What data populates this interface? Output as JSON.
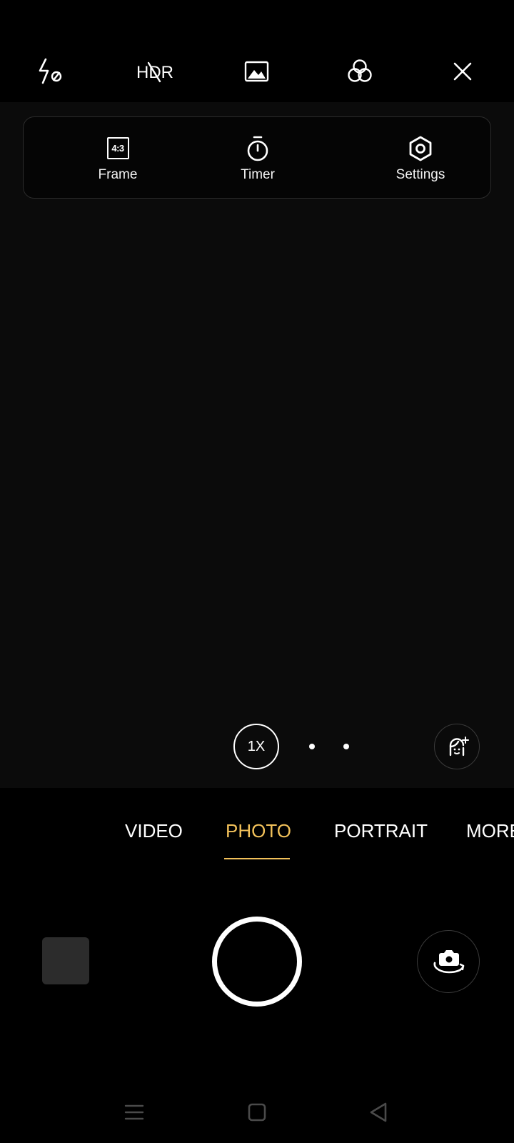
{
  "top_bar": {
    "icons": [
      "flash-off-icon",
      "hdr-off-icon",
      "image-icon",
      "filter-icon",
      "close-icon"
    ],
    "hdr_label": "HDR"
  },
  "quick_panel": {
    "frame": {
      "ratio": "4:3",
      "label": "Frame",
      "icon": "aspect-ratio-icon"
    },
    "timer": {
      "label": "Timer",
      "icon": "timer-icon"
    },
    "settings": {
      "label": "Settings",
      "icon": "settings-icon"
    }
  },
  "zoom": {
    "label": "1X"
  },
  "modes": {
    "items": [
      "VIDEO",
      "PHOTO",
      "PORTRAIT",
      "MORE"
    ],
    "selected": "PHOTO"
  },
  "controls": {
    "gallery_icon": "gallery-thumbnail",
    "shutter_icon": "shutter-button",
    "flip_icon": "flip-camera-icon"
  },
  "nav": {
    "icons": [
      "menu-icon",
      "home-icon",
      "back-icon"
    ]
  },
  "colors": {
    "accent": "#f2c15a",
    "background": "#000000",
    "viewfinder": "#0b0b0b"
  }
}
